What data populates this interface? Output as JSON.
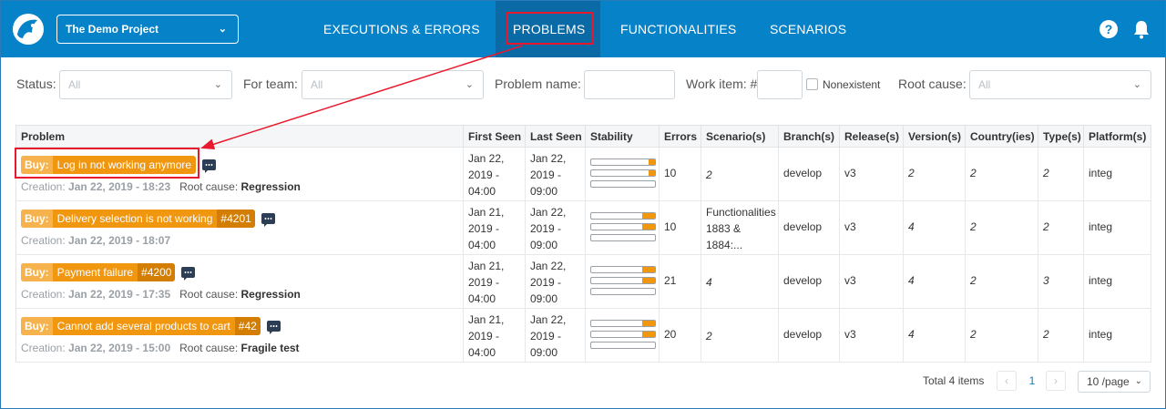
{
  "header": {
    "project": "The Demo Project",
    "nav": [
      "EXECUTIONS & ERRORS",
      "PROBLEMS",
      "FUNCTIONALITIES",
      "SCENARIOS"
    ],
    "active_tab": "PROBLEMS",
    "help_symbol": "?"
  },
  "filters": {
    "status_label": "Status:",
    "status_value": "All",
    "team_label": "For team:",
    "team_value": "All",
    "name_label": "Problem name:",
    "work_item_label": "Work item: #",
    "nonexistent_label": "Nonexistent",
    "root_cause_label": "Root cause:",
    "root_cause_value": "All"
  },
  "table": {
    "headers": [
      "Problem",
      "First Seen",
      "Last Seen",
      "Stability",
      "Errors",
      "Scenario(s)",
      "Branch(s)",
      "Release(s)",
      "Version(s)",
      "Country(ies)",
      "Type(s)",
      "Platform(s)"
    ],
    "rows": [
      {
        "prefix": "Buy:",
        "name": "Log in not working anymore",
        "work_item": "",
        "creation_label": "Creation:",
        "creation": "Jan 22, 2019 - 18:23",
        "root_cause_label": "Root cause:",
        "root_cause": "Regression",
        "first_seen": [
          "Jan 22,",
          "2019 -",
          "04:00"
        ],
        "last_seen": [
          "Jan 22,",
          "2019 -",
          "09:00"
        ],
        "stability": [
          0.1,
          0.1,
          0
        ],
        "errors": "10",
        "scenarios": [
          "2"
        ],
        "scenario_italic": true,
        "branch": "develop",
        "release": "v3",
        "version": "2",
        "country": "2",
        "type": "2",
        "platform": "integ"
      },
      {
        "prefix": "Buy:",
        "name": "Delivery selection is not working",
        "work_item": "#4201",
        "creation_label": "Creation:",
        "creation": "Jan 22, 2019 - 18:07",
        "root_cause_label": "",
        "root_cause": "",
        "first_seen": [
          "Jan 21,",
          "2019 -",
          "04:00"
        ],
        "last_seen": [
          "Jan 22,",
          "2019 -",
          "09:00"
        ],
        "stability": [
          0.2,
          0.2,
          0
        ],
        "errors": "10",
        "scenarios": [
          "Functionalities",
          "1883 &",
          "1884:..."
        ],
        "scenario_italic": false,
        "branch": "develop",
        "release": "v3",
        "version": "4",
        "country": "2",
        "type": "2",
        "platform": "integ"
      },
      {
        "prefix": "Buy:",
        "name": "Payment failure",
        "work_item": "#4200",
        "creation_label": "Creation:",
        "creation": "Jan 22, 2019 - 17:35",
        "root_cause_label": "Root cause:",
        "root_cause": "Regression",
        "first_seen": [
          "Jan 21,",
          "2019 -",
          "04:00"
        ],
        "last_seen": [
          "Jan 22,",
          "2019 -",
          "09:00"
        ],
        "stability": [
          0.2,
          0.2,
          0
        ],
        "errors": "21",
        "scenarios": [
          "4"
        ],
        "scenario_italic": true,
        "branch": "develop",
        "release": "v3",
        "version": "4",
        "country": "2",
        "type": "3",
        "platform": "integ"
      },
      {
        "prefix": "Buy:",
        "name": "Cannot add several products to cart",
        "work_item": "#42",
        "creation_label": "Creation:",
        "creation": "Jan 22, 2019 - 15:00",
        "root_cause_label": "Root cause:",
        "root_cause": "Fragile test",
        "first_seen": [
          "Jan 21,",
          "2019 -",
          "04:00"
        ],
        "last_seen": [
          "Jan 22,",
          "2019 -",
          "09:00"
        ],
        "stability": [
          0.2,
          0.2,
          0
        ],
        "errors": "20",
        "scenarios": [
          "2"
        ],
        "scenario_italic": true,
        "branch": "develop",
        "release": "v3",
        "version": "4",
        "country": "2",
        "type": "2",
        "platform": "integ"
      }
    ]
  },
  "footer": {
    "total": "Total 4 items",
    "prev": "‹",
    "page": "1",
    "next": "›",
    "page_size": "10 /page"
  },
  "colors": {
    "header_bg": "#0582c8",
    "badge": "#f0960f",
    "highlight": "#e8192c"
  },
  "icons": [
    "parrot-logo-icon",
    "chevron-down-icon",
    "help-icon",
    "bell-icon",
    "comment-icon",
    "chevron-left-icon",
    "chevron-right-icon"
  ]
}
